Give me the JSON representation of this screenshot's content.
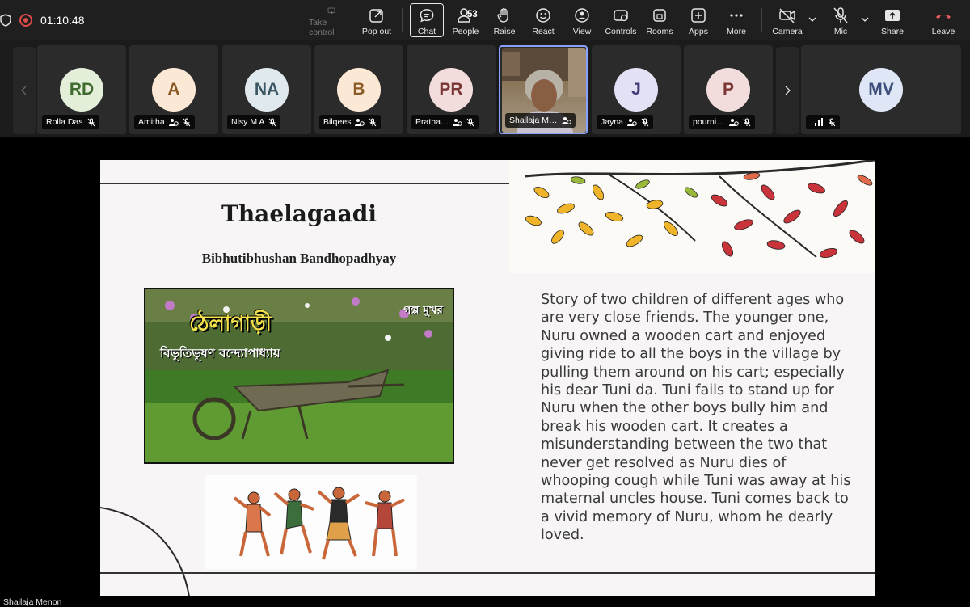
{
  "meeting": {
    "timer": "01:10:48",
    "people_count": "53"
  },
  "toolbar": {
    "take_control": "Take control",
    "pop_out": "Pop out",
    "chat": "Chat",
    "people": "People",
    "raise": "Raise",
    "react": "React",
    "view": "View",
    "controls": "Controls",
    "rooms": "Rooms",
    "apps": "Apps",
    "more": "More",
    "camera": "Camera",
    "mic": "Mic",
    "share": "Share",
    "leave": "Leave"
  },
  "participants": [
    {
      "initials": "RD",
      "name": "Rolla Das",
      "avatar_bg": "#e4efd9",
      "avatar_fg": "#3f6b2e"
    },
    {
      "initials": "A",
      "name": "Amitha",
      "avatar_bg": "#fbe9d6",
      "avatar_fg": "#8a5a24"
    },
    {
      "initials": "NA",
      "name": "Nisy M A",
      "avatar_bg": "#dfe9ee",
      "avatar_fg": "#3c5663"
    },
    {
      "initials": "B",
      "name": "Bilqees",
      "avatar_bg": "#fbe9d6",
      "avatar_fg": "#8a5a24"
    },
    {
      "initials": "PR",
      "name": "Pratha…",
      "avatar_bg": "#f2dcdc",
      "avatar_fg": "#7a3535"
    },
    {
      "initials": "",
      "name": "Shailaja M…",
      "avatar_bg": "",
      "avatar_fg": ""
    },
    {
      "initials": "J",
      "name": "Jayna",
      "avatar_bg": "#e3e1f5",
      "avatar_fg": "#423c7a"
    },
    {
      "initials": "P",
      "name": "pourni…",
      "avatar_bg": "#f2dcdc",
      "avatar_fg": "#7a3535"
    },
    {
      "initials": "MV",
      "name": "",
      "avatar_bg": "#dfe6f5",
      "avatar_fg": "#3b4f7a"
    }
  ],
  "slide": {
    "title": "Thaelagaadi",
    "author": "Bibhutibhushan Bandhopadhyay",
    "photo_title": "ঠেলাগাড়ী",
    "photo_subtitle": "বিভূতিভূষণ বন্দ্যোপাধ্যায়",
    "photo_badge": "গল্প মুখর",
    "story": "Story of two children of different ages who are very close friends. The younger one, Nuru owned a wooden cart and enjoyed giving ride to all the boys in the village by pulling them around on his cart; especially his dear Tuni da. Tuni fails to stand up for Nuru when the other boys bully him and break his wooden cart. It creates a misunderstanding between the two that never get resolved as Nuru dies of whooping cough while Tuni was away at his maternal uncles house. Tuni comes back to a vivid memory of Nuru, whom he dearly loved."
  },
  "presenter": {
    "name": "Shailaja Menon"
  }
}
